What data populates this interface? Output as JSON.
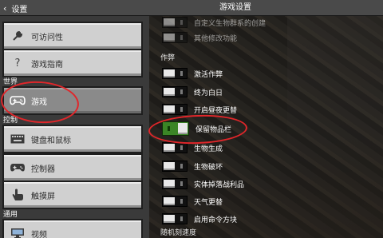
{
  "header": {
    "back_label": "设置",
    "title": "游戏设置"
  },
  "sidebar": {
    "items": [
      {
        "label": "可访问性",
        "icon": "wrench-icon"
      },
      {
        "label": "游戏指南",
        "icon": "question-icon"
      },
      {
        "label": "游戏",
        "icon": "controller-icon"
      },
      {
        "label": "键盘和鼠标",
        "icon": "keyboard-icon"
      },
      {
        "label": "控制器",
        "icon": "gamepad-icon"
      },
      {
        "label": "触摸屏",
        "icon": "touch-icon"
      },
      {
        "label": "视频",
        "icon": "monitor-icon"
      }
    ],
    "sections": {
      "world": "世界",
      "controls": "控制",
      "general": "通用"
    }
  },
  "main": {
    "groups": {
      "cheats": "作弊",
      "random_tick": "随机刻速度"
    },
    "toggles": [
      {
        "label": "自定义生物群系的创建",
        "on": false
      },
      {
        "label": "其他修改功能",
        "on": false
      },
      {
        "label": "激活作弊",
        "on": false
      },
      {
        "label": "终为白日",
        "on": false
      },
      {
        "label": "开启昼夜更替",
        "on": false
      },
      {
        "label": "保留物品栏",
        "on": true
      },
      {
        "label": "生物生成",
        "on": false
      },
      {
        "label": "生物破坏",
        "on": false
      },
      {
        "label": "实体掉落战利品",
        "on": false
      },
      {
        "label": "天气更替",
        "on": false
      },
      {
        "label": "启用命令方块",
        "on": false
      }
    ]
  },
  "colors": {
    "toggle_on": "#3b8526",
    "annotation": "#e0262a",
    "selected_tab": "#8a8a8a"
  }
}
